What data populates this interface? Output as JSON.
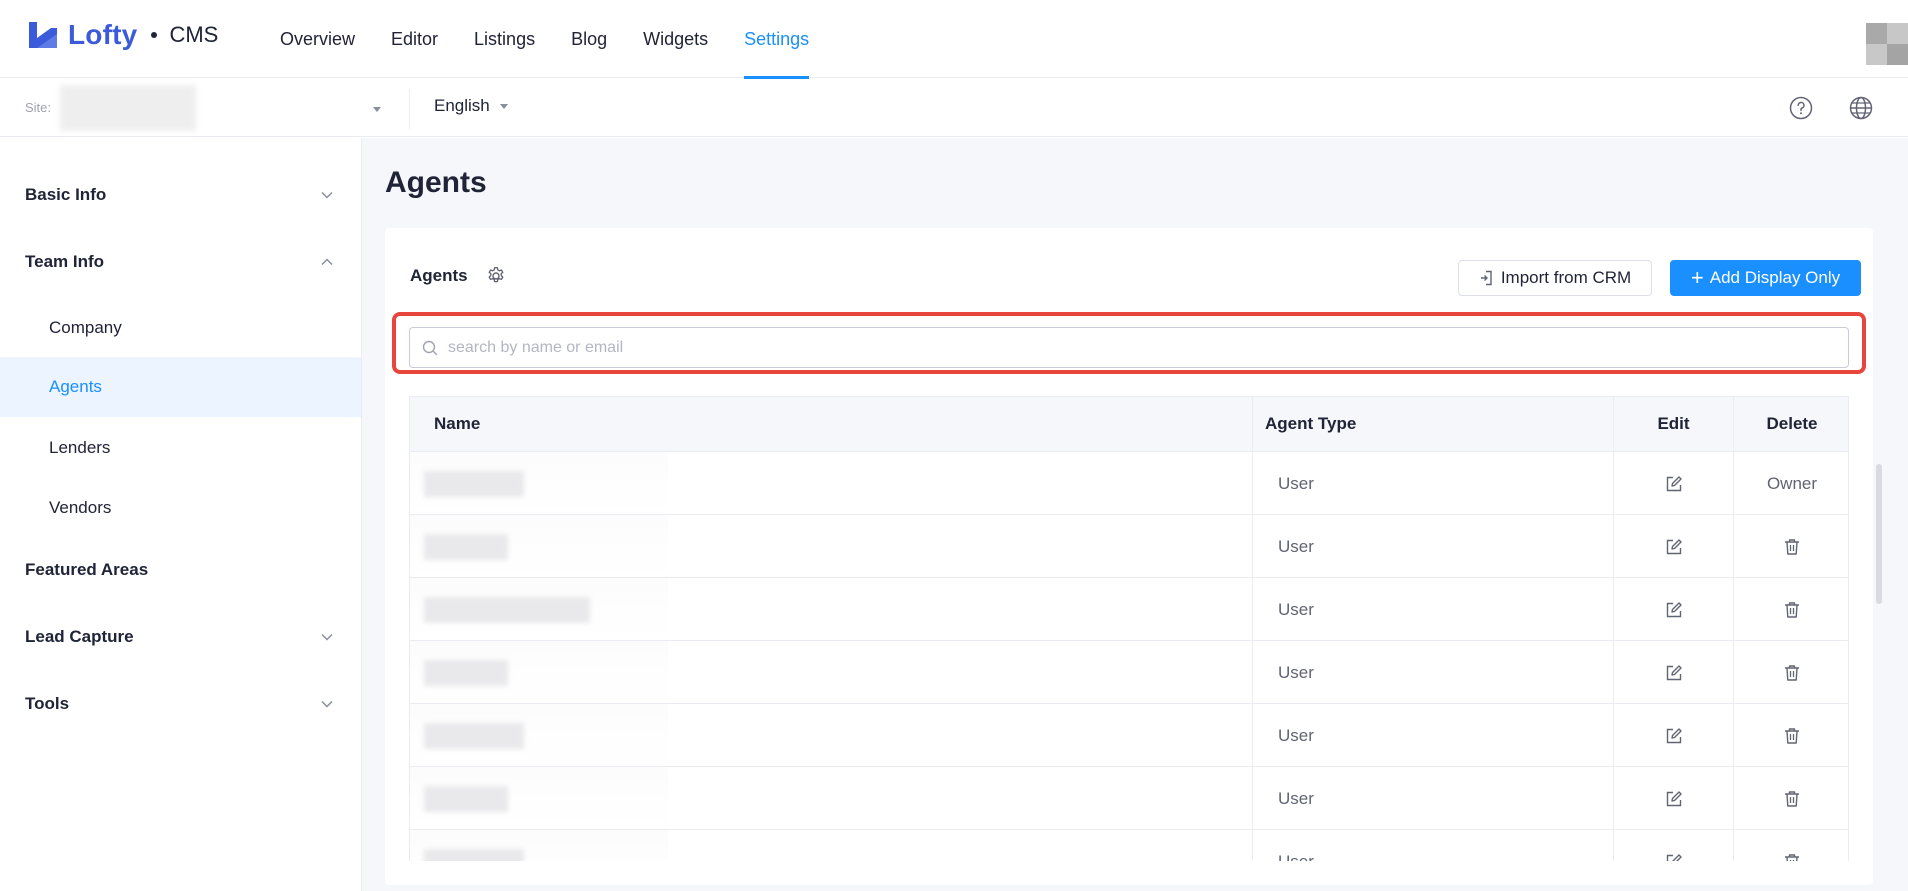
{
  "app": {
    "brand": "Lofty",
    "product": "CMS",
    "colors": {
      "accent": "#1a8fff",
      "brand": "#3b5bdb",
      "highlight": "#e8453c"
    }
  },
  "nav": {
    "items": [
      {
        "label": "Overview"
      },
      {
        "label": "Editor"
      },
      {
        "label": "Listings"
      },
      {
        "label": "Blog"
      },
      {
        "label": "Widgets"
      },
      {
        "label": "Settings",
        "active": true
      }
    ]
  },
  "subbar": {
    "site_label": "Site:",
    "language": "English",
    "icons": [
      "question-circle-icon",
      "globe-icon"
    ]
  },
  "sidebar": {
    "items": [
      {
        "label": "Basic Info",
        "type": "group",
        "chevron": "down"
      },
      {
        "label": "Team Info",
        "type": "group",
        "chevron": "up"
      },
      {
        "label": "Company",
        "type": "sub"
      },
      {
        "label": "Agents",
        "type": "sub",
        "active": true
      },
      {
        "label": "Lenders",
        "type": "sub"
      },
      {
        "label": "Vendors",
        "type": "sub"
      },
      {
        "label": "Featured Areas",
        "type": "group"
      },
      {
        "label": "Lead Capture",
        "type": "group",
        "chevron": "down"
      },
      {
        "label": "Tools",
        "type": "group",
        "chevron": "down"
      }
    ]
  },
  "main": {
    "title": "Agents",
    "panel_title": "Agents",
    "import_button": "Import from CRM",
    "add_button": "Add Display Only",
    "search": {
      "placeholder": "search by name or email",
      "value": ""
    },
    "table": {
      "headers": {
        "name": "Name",
        "type": "Agent Type",
        "edit": "Edit",
        "delete": "Delete"
      },
      "rows": [
        {
          "type": "User",
          "delete": "Owner"
        },
        {
          "type": "User",
          "delete": ""
        },
        {
          "type": "User",
          "delete": ""
        },
        {
          "type": "User",
          "delete": ""
        },
        {
          "type": "User",
          "delete": ""
        },
        {
          "type": "User",
          "delete": ""
        },
        {
          "type": "User",
          "delete": ""
        }
      ]
    }
  }
}
